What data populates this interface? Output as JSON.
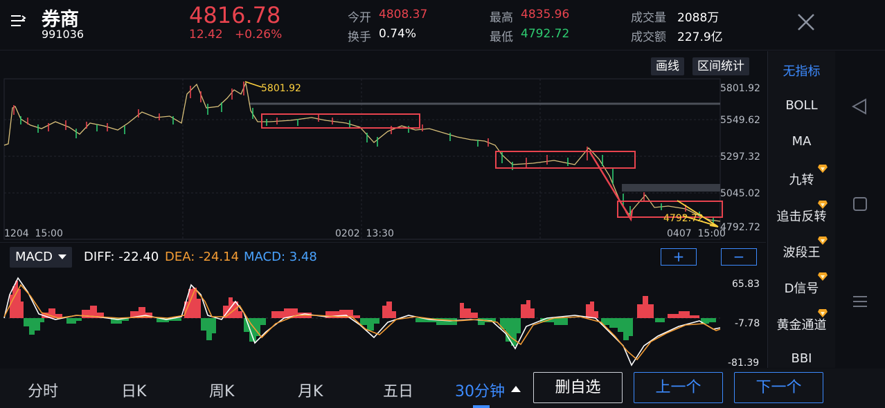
{
  "header": {
    "name": "券商",
    "code": "991036",
    "price": "4816.78",
    "change": "12.42",
    "change_pct": "+0.26%",
    "open_label": "今开",
    "open": "4808.37",
    "turnover_label": "换手",
    "turnover": "0.74%",
    "high_label": "最高",
    "high": "4835.96",
    "low_label": "最低",
    "low": "4792.72",
    "volume_label": "成交量",
    "volume": "2088万",
    "amount_label": "成交额",
    "amount": "227.9亿"
  },
  "toolbar": {
    "draw_label": "画线",
    "range_label": "区间统计"
  },
  "chart": {
    "price_axis": [
      "5801.92",
      "5549.62",
      "5297.32",
      "5045.02",
      "4792.72"
    ],
    "time_axis": [
      "1204  15:00",
      "0202  13:30",
      "0407  15:00"
    ],
    "high_mark": "5801.92",
    "low_mark": "4792.72"
  },
  "macd": {
    "selector": "MACD",
    "diff": "DIFF: -22.40",
    "dea": "DEA: -24.14",
    "macd": "MACD: 3.48",
    "axis": [
      "65.83",
      "-7.78",
      "-81.39"
    ],
    "plus": "+",
    "minus": "−"
  },
  "indicators": [
    "无指标",
    "BOLL",
    "MA",
    "九转",
    "追击反转",
    "波段王",
    "D信号",
    "黄金通道",
    "BBI"
  ],
  "bottom": {
    "tabs": [
      "分时",
      "日K",
      "周K",
      "月K",
      "五日",
      "30分钟"
    ],
    "del_label": "删自选",
    "prev_label": "上一个",
    "next_label": "下一个"
  },
  "colors": {
    "up": "#e8434e",
    "down": "#2ecc71",
    "accent": "#3d8bff",
    "highlight": "#ffd23f",
    "gem": "#f5a623"
  },
  "icons": [
    "menu-icon",
    "close-icon",
    "back-triangle-icon",
    "square-icon",
    "hamburger-icon",
    "gem-icon",
    "caret-down-icon",
    "caret-up-icon"
  ]
}
